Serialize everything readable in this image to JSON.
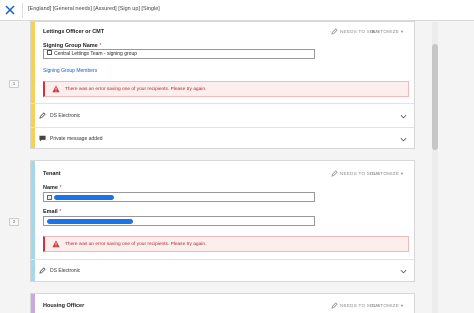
{
  "header": {
    "title": "[England] [General needs] [Assured] [Sign up] [Single]"
  },
  "recipients": [
    {
      "order": "1",
      "role": "Lettings Officer or CMT",
      "action_label": "NEEDS TO SIGN",
      "customize_label": "CUSTOMIZE",
      "field_label": "Signing Group Name",
      "field_value": "Central Lettings Team - signing group",
      "link": "Signing Group Members",
      "error": "There was an error saving one of your recipients. Please try again.",
      "delivery": "DS Electronic",
      "private_message": "Private message added"
    },
    {
      "order": "2",
      "role": "Tenant",
      "action_label": "NEEDS TO SIGN",
      "customize_label": "CUSTOMIZE",
      "name_label": "Name",
      "email_label": "Email",
      "error": "There was an error saving one of your recipients. Please try again.",
      "delivery": "DS Electronic"
    },
    {
      "role": "Housing Officer",
      "action_label": "NEEDS TO SIGN",
      "customize_label": "CUSTOMIZE"
    }
  ],
  "required_mark": "*",
  "colors": {
    "stripe_1": "#f7d154",
    "stripe_2": "#a7d8ea",
    "stripe_3": "#c9a8dc",
    "error": "#d13239",
    "link": "#1a5fc4"
  }
}
